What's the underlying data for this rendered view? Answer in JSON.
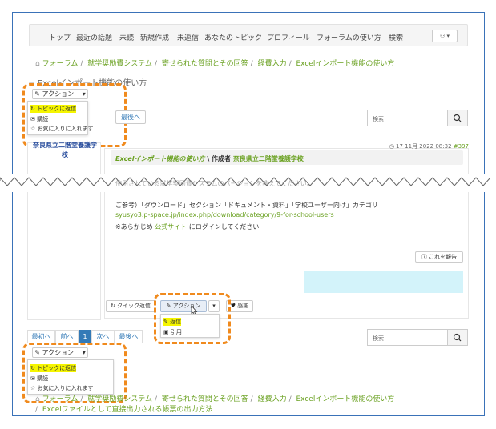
{
  "nav": {
    "items": [
      "トップ",
      "最近の話題",
      "未読",
      "新規作成",
      "未返信",
      "あなたのトピック",
      "プロフィール",
      "フォーラムの使い方",
      "検索"
    ]
  },
  "breadcrumb_top": [
    "フォーラム",
    "就学奨励費システム",
    "寄せられた質問とその回答",
    "経費入力",
    "Excelインポート機能の使い方"
  ],
  "page_title": "Excelインポート機能の使い方",
  "action_menu": {
    "button": "アクション",
    "items": [
      "トピックに返信",
      "購読",
      "お気に入りに入れます"
    ]
  },
  "pager_top": {
    "last": "最後へ"
  },
  "search": {
    "placeholder": "検索"
  },
  "author": {
    "name": "奈良県立二階堂養護学校"
  },
  "post": {
    "timestamp": "17 11月 2022 08:32",
    "number": "#397",
    "title": "Excelインポート機能の使い方",
    "by": "\\ 作成者",
    "author": "奈良県立二階堂養護学校",
    "line1": "使用されている就学奨励費システムのバージョンを教えてください。",
    "line2": "ご参考）「ダウンロード」セクション「ドキュメント・資料」「学校ユーザー向け」カテゴリ",
    "link": "syusyo3.p-space.jp/index.php/download/category/9-for-school-users",
    "line3_pre": "※あらかじめ",
    "line3_link": "公式サイト",
    "line3_post": "にログインしてください",
    "report": "これを報告",
    "quick_reply": "クイック返信",
    "action": "アクション",
    "thanks": "感謝",
    "action_items": [
      "返信",
      "引用"
    ]
  },
  "pager_bottom": [
    "最初へ",
    "前へ",
    "1",
    "次へ",
    "最後へ"
  ],
  "breadcrumb_bottom": [
    "フォーラム",
    "就学奨励費システム",
    "寄せられた質問とその回答",
    "経費入力",
    "Excelインポート機能の使い方",
    "Excelファイルとして直接出力される帳票の出力方法"
  ],
  "colors": {
    "accent_green": "#6aa121",
    "highlight": "#f5f500",
    "callout_orange": "#f08a1d"
  }
}
